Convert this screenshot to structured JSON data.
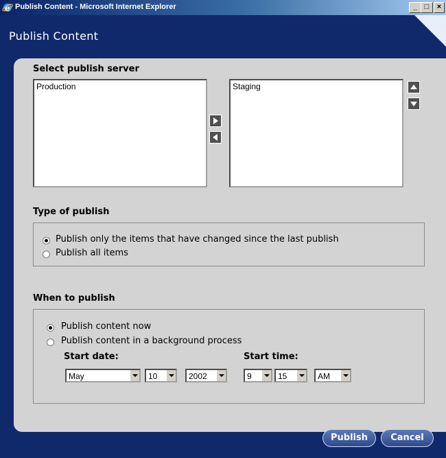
{
  "window": {
    "title": "Publish Content - Microsoft Internet Explorer",
    "minimize": "_",
    "maximize": "□",
    "close": "×"
  },
  "app": {
    "title": "Publish Content"
  },
  "server": {
    "heading": "Select publish server",
    "available": [
      "Production"
    ],
    "selected": [
      "Staging"
    ]
  },
  "type": {
    "heading": "Type of publish",
    "options": [
      {
        "label": "Publish only the items that have changed since the last publish",
        "checked": true
      },
      {
        "label": "Publish all items",
        "checked": false
      }
    ]
  },
  "when": {
    "heading": "When to publish",
    "options": [
      {
        "label": "Publish content now",
        "checked": true
      },
      {
        "label": "Publish content in a background process",
        "checked": false
      }
    ],
    "start_date_label": "Start date:",
    "start_time_label": "Start time:",
    "month": "May",
    "day": "10",
    "year": "2002",
    "hour": "9",
    "minute": "15",
    "ampm": "AM"
  },
  "buttons": {
    "publish": "Publish",
    "cancel": "Cancel"
  }
}
